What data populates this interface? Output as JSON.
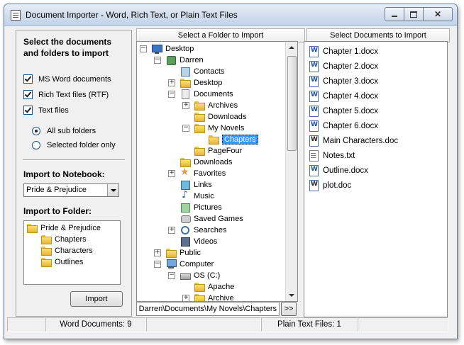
{
  "window": {
    "title": "Document Importer - Word, Rich Text, or Plain Text Files"
  },
  "left_panel": {
    "heading": "Select the documents and folders to import",
    "checkboxes": [
      {
        "label": "MS Word documents",
        "checked": true
      },
      {
        "label": "Rich Text files (RTF)",
        "checked": true
      },
      {
        "label": "Text files",
        "checked": true
      }
    ],
    "radios": [
      {
        "label": "All sub folders",
        "selected": true
      },
      {
        "label": "Selected folder only",
        "selected": false
      }
    ],
    "notebook_label": "Import to Notebook:",
    "notebook_value": "Pride & Prejudice",
    "folder_label": "Import to Folder:",
    "folder_tree": {
      "root": "Pride & Prejudice",
      "children": [
        "Chapters",
        "Characters",
        "Outlines"
      ]
    },
    "import_button": "Import"
  },
  "folder_pane": {
    "header": "Select a Folder to Import",
    "tree": [
      {
        "label": "Desktop",
        "icon": "desktop-icon"
      },
      {
        "label": "Darren",
        "icon": "user-folder-icon"
      },
      {
        "label": "Contacts",
        "icon": "contacts-icon"
      },
      {
        "label": "Desktop",
        "icon": "folder-icon"
      },
      {
        "label": "Documents",
        "icon": "documents-icon"
      },
      {
        "label": "Archives",
        "icon": "folder-icon"
      },
      {
        "label": "Downloads",
        "icon": "folder-icon"
      },
      {
        "label": "My Novels",
        "icon": "folder-icon"
      },
      {
        "label": "Chapters",
        "icon": "folder-icon",
        "selected": true
      },
      {
        "label": "PageFour",
        "icon": "folder-icon"
      },
      {
        "label": "Downloads",
        "icon": "folder-icon"
      },
      {
        "label": "Favorites",
        "icon": "favorites-icon"
      },
      {
        "label": "Links",
        "icon": "links-icon"
      },
      {
        "label": "Music",
        "icon": "music-icon"
      },
      {
        "label": "Pictures",
        "icon": "pictures-icon"
      },
      {
        "label": "Saved Games",
        "icon": "saved-games-icon"
      },
      {
        "label": "Searches",
        "icon": "searches-icon"
      },
      {
        "label": "Videos",
        "icon": "videos-icon"
      },
      {
        "label": "Public",
        "icon": "folder-icon"
      },
      {
        "label": "Computer",
        "icon": "computer-icon"
      },
      {
        "label": "OS (C:)",
        "icon": "drive-icon"
      },
      {
        "label": "Apache",
        "icon": "folder-icon"
      },
      {
        "label": "Archive",
        "icon": "folder-icon"
      }
    ],
    "path": "Darren\\Documents\\My Novels\\Chapters",
    "more_button": ">>"
  },
  "documents_pane": {
    "header": "Select Documents to Import",
    "files": [
      {
        "name": "Chapter 1.docx",
        "icon": "docx-icon"
      },
      {
        "name": "Chapter 2.docx",
        "icon": "docx-icon"
      },
      {
        "name": "Chapter 3.docx",
        "icon": "docx-icon"
      },
      {
        "name": "Chapter 4.docx",
        "icon": "docx-icon"
      },
      {
        "name": "Chapter 5.docx",
        "icon": "docx-icon"
      },
      {
        "name": "Chapter 6.docx",
        "icon": "docx-icon"
      },
      {
        "name": "Main Characters.doc",
        "icon": "doc-icon"
      },
      {
        "name": "Notes.txt",
        "icon": "txt-icon"
      },
      {
        "name": "Outline.docx",
        "icon": "docx-icon"
      },
      {
        "name": "plot.doc",
        "icon": "doc-icon"
      }
    ]
  },
  "status_bar": {
    "word_documents": "Word Documents: 9",
    "plain_text_files": "Plain Text Files: 1"
  },
  "colors": {
    "selection": "#3399ff",
    "title_bar": "#cfdcec"
  }
}
